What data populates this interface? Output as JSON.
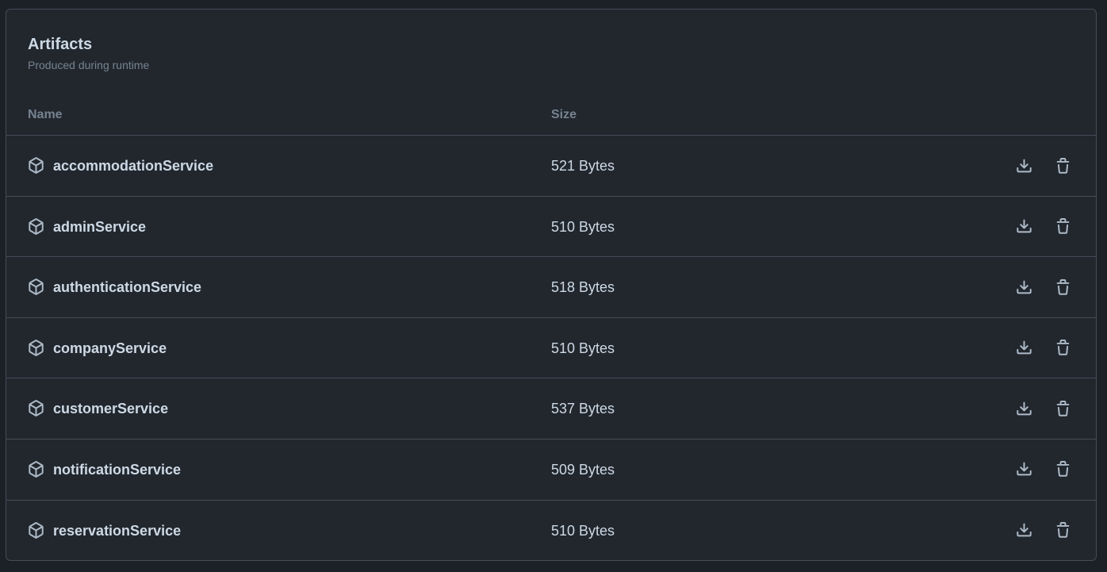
{
  "panel": {
    "title": "Artifacts",
    "subtitle": "Produced during runtime"
  },
  "table": {
    "headers": {
      "name": "Name",
      "size": "Size"
    },
    "rows": [
      {
        "name": "accommodationService",
        "size": "521 Bytes"
      },
      {
        "name": "adminService",
        "size": "510 Bytes"
      },
      {
        "name": "authenticationService",
        "size": "518 Bytes"
      },
      {
        "name": "companyService",
        "size": "510 Bytes"
      },
      {
        "name": "customerService",
        "size": "537 Bytes"
      },
      {
        "name": "notificationService",
        "size": "509 Bytes"
      },
      {
        "name": "reservationService",
        "size": "510 Bytes"
      }
    ]
  },
  "icons": {
    "row_icon": "package-icon",
    "download": "download-icon",
    "delete": "trash-icon"
  },
  "colors": {
    "page_background": "#1c2128",
    "panel_background": "#22272e",
    "border": "#444c56",
    "text_primary": "#cdd9e5",
    "text_muted": "#768390",
    "icon": "#adbac7"
  }
}
